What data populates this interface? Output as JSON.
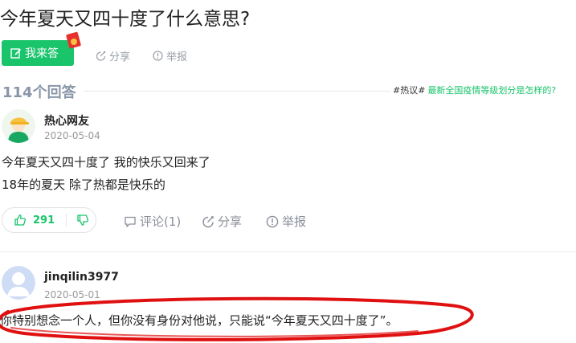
{
  "question": {
    "title": "今年夏天又四十度了什么意思?"
  },
  "toolbar": {
    "answer_label": "我来答",
    "share_label": "分享",
    "report_label": "举报"
  },
  "answers_header": {
    "count_label": "114个回答",
    "hot_tag": "#热议#",
    "hot_link": "最新全国疫情等级划分是怎样的?"
  },
  "answers": [
    {
      "username": "热心网友",
      "date": "2020-05-04",
      "lines": [
        "今年夏天又四十度了 我的快乐又回来了",
        "18年的夏天 除了热都是快乐的"
      ],
      "likes": "291",
      "comment_label": "评论(1)",
      "share_label": "分享",
      "report_label": "举报"
    },
    {
      "username": "jinqilin3977",
      "date": "2020-05-01",
      "lines": [
        "你特别想念一个人，但你没有身份对他说，只能说“今年夏天又四十度了”。"
      ]
    }
  ],
  "colors": {
    "accent": "#19c46b",
    "highlight_oval": "#e01010",
    "muted": "#9aa0a6"
  }
}
